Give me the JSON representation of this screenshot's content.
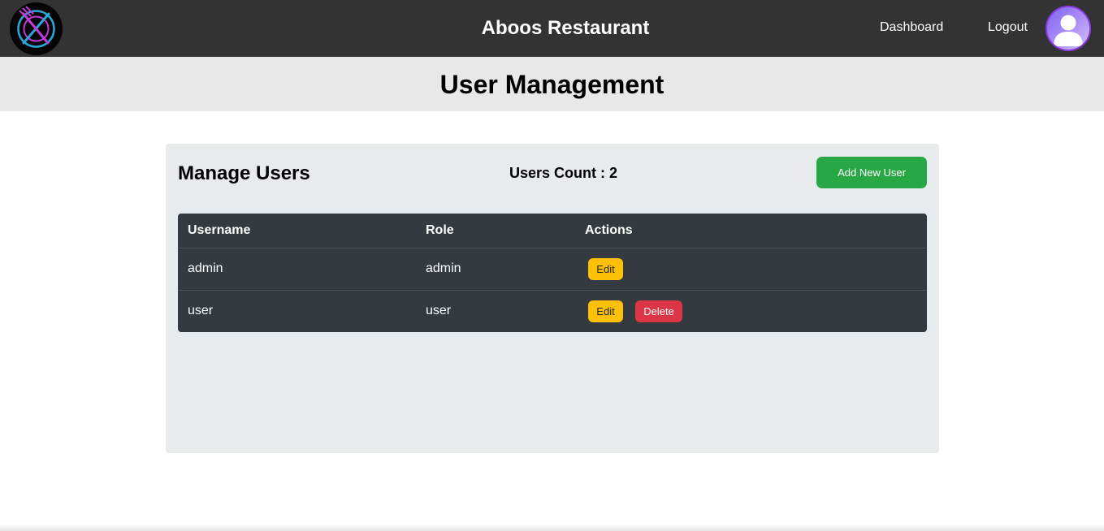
{
  "header": {
    "app_title": "Aboos Restaurant",
    "nav": {
      "dashboard": "Dashboard",
      "logout": "Logout"
    },
    "logo_icon": "fork-knife-plate-icon",
    "avatar_icon": "user-avatar-icon"
  },
  "page": {
    "title": "User Management"
  },
  "panel": {
    "title": "Manage Users",
    "users_count": "Users Count : 2",
    "add_button": "Add New User"
  },
  "table": {
    "columns": [
      "Username",
      "Role",
      "Actions"
    ],
    "rows": [
      {
        "username": "admin",
        "role": "admin",
        "edit": "Edit"
      },
      {
        "username": "user",
        "role": "user",
        "edit": "Edit",
        "delete": "Delete"
      }
    ]
  },
  "colors": {
    "topbar": "#333333",
    "success": "#28a745",
    "warning": "#ffc107",
    "danger": "#dc3545",
    "table_bg": "#343a40"
  }
}
